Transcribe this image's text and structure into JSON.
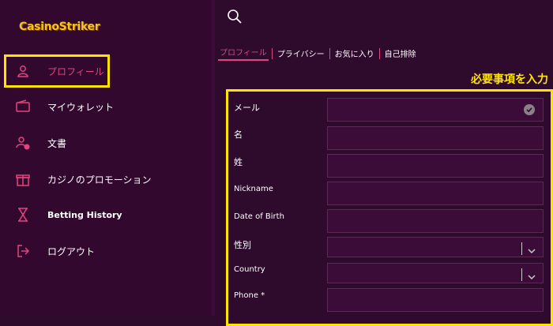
{
  "brand": {
    "logo_text": "CasinoStriker"
  },
  "sidebar": {
    "items": [
      {
        "label": "プロフィール",
        "icon": "user-icon"
      },
      {
        "label": "マイウォレット",
        "icon": "wallet-icon"
      },
      {
        "label": "文書",
        "icon": "user-check-icon"
      },
      {
        "label": "カジノのプロモーション",
        "icon": "gift-icon"
      },
      {
        "label": "Betting History",
        "icon": "hourglass-icon"
      },
      {
        "label": "ログアウト",
        "icon": "logout-icon"
      }
    ]
  },
  "tabs": [
    {
      "label": "プロフィール",
      "active": true
    },
    {
      "label": "プライバシー"
    },
    {
      "label": "お気に入り"
    },
    {
      "label": "自己排除"
    }
  ],
  "annotation": {
    "required_note": "必要事項を入力"
  },
  "form": {
    "fields": [
      {
        "label": "メール",
        "value": ""
      },
      {
        "label": "名",
        "value": ""
      },
      {
        "label": "姓",
        "value": ""
      },
      {
        "label": "Nickname",
        "value": ""
      },
      {
        "label": "Date of Birth",
        "value": ""
      },
      {
        "label": "性別",
        "value": ""
      },
      {
        "label": "Country",
        "value": ""
      },
      {
        "label": "Phone *",
        "value": ""
      }
    ]
  },
  "colors": {
    "accent": "#e0457e",
    "highlight": "#ffe400",
    "background": "#2e0a2d"
  }
}
